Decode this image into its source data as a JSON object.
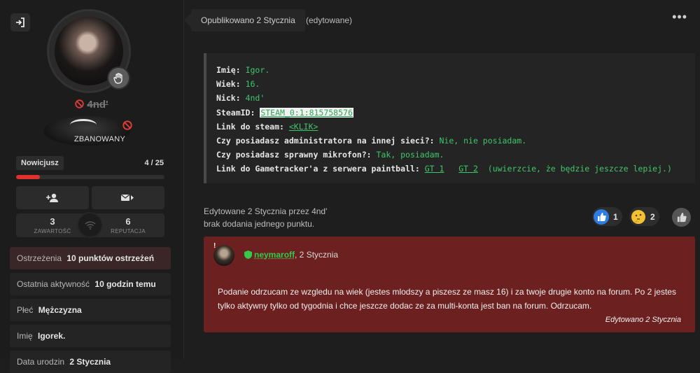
{
  "profile": {
    "username": "4nd'",
    "ban_label": "ZBANOWANY",
    "rank": "Nowicjusz",
    "rank_progress": "4 / 25",
    "rank_progress_fraction": 0.16,
    "stats": [
      {
        "value": "3",
        "label": "ZAWARTOŚĆ"
      },
      {
        "value": "6",
        "label": "REPUTACJA"
      }
    ],
    "fields": [
      {
        "label": "Ostrzeżenia",
        "value": "10 punktów ostrzeżeń"
      },
      {
        "label": "Ostatnia aktywność",
        "value": "10 godzin temu"
      },
      {
        "label": "Płeć",
        "value": "Mężczyzna"
      },
      {
        "label": "Imię",
        "value": "Igorek."
      },
      {
        "label": "Data urodzin",
        "value": "2 Stycznia"
      }
    ]
  },
  "post": {
    "published": "Opublikowano 2 Stycznia",
    "edited_tag": "(edytowane)",
    "menu_icon": "•••",
    "lines": [
      {
        "key": "Imię:",
        "value": "Igor."
      },
      {
        "key": "Wiek:",
        "value": "16."
      },
      {
        "key": "Nick:",
        "value": "4nd'"
      },
      {
        "key": "SteamID:",
        "value": "STEAM_0:1:815758576"
      },
      {
        "key": "Link do steam:",
        "value": "<KLIK>"
      },
      {
        "key": "Czy posiadasz administratora na innej sieci?:",
        "value": "Nie, nie posiadam."
      },
      {
        "key": "Czy posiadasz sprawny mikrofon?:",
        "value": "Tak, posiadam."
      },
      {
        "key": "Link do Gametracker'a z serwera paintball:",
        "link1": "GT 1",
        "link2": "GT 2",
        "value": "(uwierzcie, że będzie jeszcze lepiej.)"
      }
    ],
    "edit_note": "Edytowane 2 Stycznia przez 4nd'",
    "edit_reason": "brak dodania jednego punktu.",
    "reactions": [
      {
        "icon": "like-icon",
        "count": "1",
        "color": "#2f7de1"
      },
      {
        "icon": "thinking-icon",
        "count": "2",
        "color": "#f4c132"
      }
    ]
  },
  "moderation": {
    "author": "neymaroff",
    "date": ", 2 Stycznia",
    "text": "Podanie odrzucam ze wzgledu na wiek (jestes mlodszy a piszesz ze masz 16) i za twoje drugie konto na forum. Po 2 jestes tylko aktywny tylko od tygodnia i chce jeszcze dodac ze za multi-konta jest ban na forum. Odrzucam.",
    "edited": "Edytowano 2 Stycznia",
    "box_color": "#6d2020"
  }
}
